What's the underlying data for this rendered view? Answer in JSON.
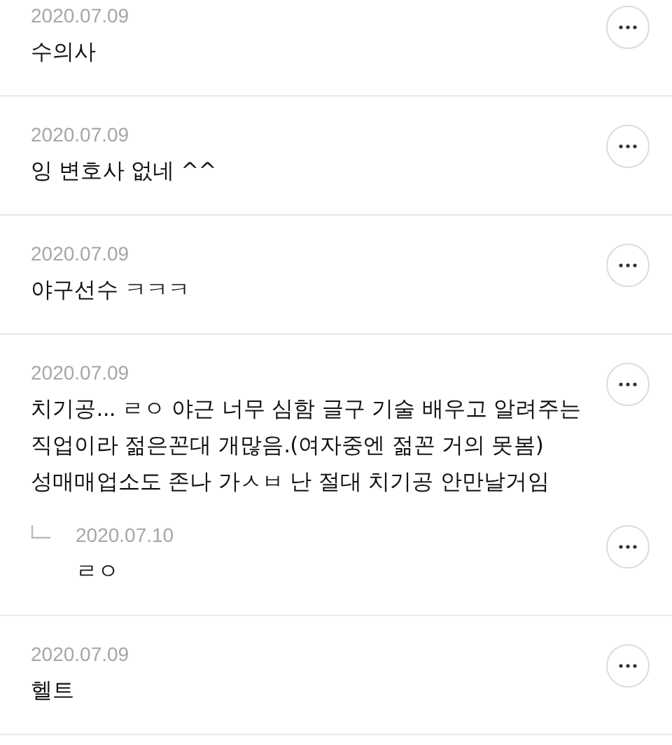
{
  "comments": [
    {
      "date": "2020.07.09",
      "text": "수의사"
    },
    {
      "date": "2020.07.09",
      "text": "잉 변호사 없네 ^^"
    },
    {
      "date": "2020.07.09",
      "text": "야구선수 ㅋㅋㅋ"
    },
    {
      "date": "2020.07.09",
      "text": "치기공... ㄹㅇ 야근 너무 심함 글구 기술 배우고 알려주는 직업이라 젊은꼰대 개많음.(여자중엔 젊꼰 거의 못봄) 성매매업소도 존나 가ㅅㅂ 난 절대 치기공 안만날거임",
      "children": [
        {
          "date": "2020.07.10",
          "text": "ㄹㅇ"
        }
      ]
    },
    {
      "date": "2020.07.09",
      "text": "헬트"
    }
  ]
}
